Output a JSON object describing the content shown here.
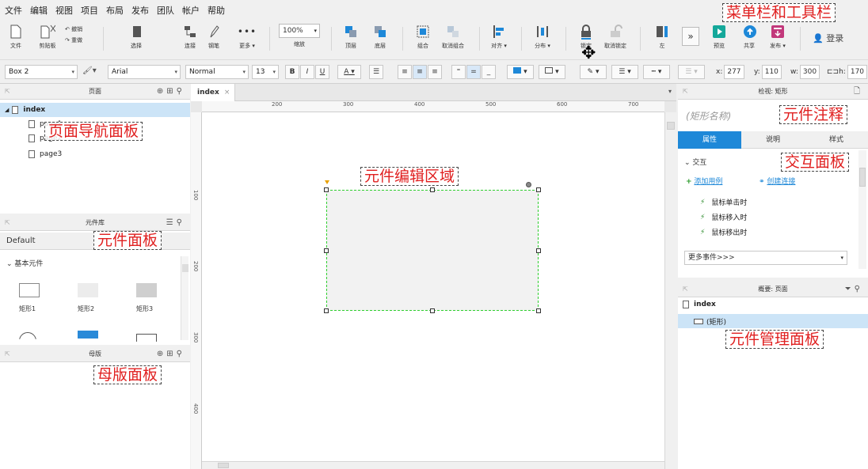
{
  "menu": [
    "文件",
    "编辑",
    "视图",
    "项目",
    "布局",
    "发布",
    "团队",
    "帐户",
    "帮助"
  ],
  "toolbar": {
    "file": "文件",
    "clipboard": "剪贴板",
    "undo": "撤销",
    "redo": "重做",
    "select": "选择",
    "connect": "连接",
    "pen": "钢笔",
    "more": "更多 ▾",
    "zoom_value": "100%",
    "zoom_label": "缩放",
    "top": "顶层",
    "bottom": "底层",
    "group": "组合",
    "ungroup": "取消组合",
    "align": "对齐 ▾",
    "distribute": "分布 ▾",
    "lock": "锁定",
    "unlock": "取消锁定",
    "left": "左",
    "preview": "预览",
    "share": "共享",
    "publish": "发布 ▾",
    "login": "登录"
  },
  "format": {
    "widget_name": "Box 2",
    "font": "Arial",
    "weight": "Normal",
    "size": "13",
    "bold": "B",
    "italic": "I",
    "underline": "U",
    "font_color": "A",
    "x_label": "x:",
    "x_value": "277",
    "y_label": "y:",
    "y_value": "110",
    "w_label": "w:",
    "w_value": "300",
    "h_label": "h:",
    "h_value": "170"
  },
  "pages_panel": {
    "title": "页面",
    "root": "index",
    "pages": [
      "page1",
      "page2",
      "page3"
    ]
  },
  "library_panel": {
    "title": "元件库",
    "selected": "Default",
    "section": "基本元件",
    "widgets": [
      "矩形1",
      "矩形2",
      "矩形3"
    ]
  },
  "masters_panel": {
    "title": "母版"
  },
  "editor": {
    "tab": "index",
    "tab_close": "×",
    "ruler_h": [
      "200",
      "300",
      "400",
      "500",
      "600",
      "700"
    ],
    "ruler_v": [
      "100",
      "200",
      "300",
      "400"
    ]
  },
  "inspector": {
    "title": "检视: 矩形",
    "widget_name_placeholder": "(矩形名称)",
    "tabs": [
      "属性",
      "说明",
      "样式"
    ],
    "section": "交互",
    "add_case": "添加用例",
    "create_link": "创建连接",
    "events": [
      "鼠标单击时",
      "鼠标移入时",
      "鼠标移出时"
    ],
    "more_events": "更多事件>>>"
  },
  "outline": {
    "title": "概要: 页面",
    "root": "index",
    "item": "(矩形)"
  },
  "annotations": {
    "menubar": "菜单栏和工具栏",
    "widget_note": "元件注释",
    "pages": "页面导航面板",
    "editor": "元件编辑区域",
    "interaction": "交互面板",
    "library": "元件面板",
    "masters": "母版面板",
    "outline": "元件管理面板"
  },
  "colors": {
    "accent": "#1e88d8",
    "annotation_text": "#e02020",
    "selection": "#2fcf2f",
    "tab_active": "#1e88d8"
  }
}
